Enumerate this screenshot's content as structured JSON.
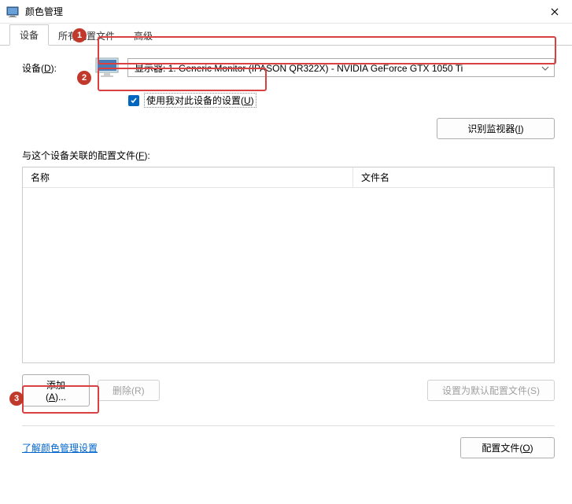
{
  "window": {
    "title": "颜色管理"
  },
  "tabs": {
    "device": "设备",
    "all_profiles": "所有配置文件",
    "advanced": "高级"
  },
  "device_section": {
    "label_prefix": "设备(",
    "label_key": "D",
    "label_suffix": "):",
    "dropdown_value": "显示器: 1. Generic Monitor (IPASON QR322X) - NVIDIA GeForce GTX 1050 Ti"
  },
  "checkbox": {
    "label_prefix": "使用我对此设备的设置(",
    "label_key": "U",
    "label_suffix": ")"
  },
  "identify_button": {
    "label_prefix": "识别监视器(",
    "label_key": "I",
    "label_suffix": ")"
  },
  "assoc": {
    "label_prefix": "与这个设备关联的配置文件(",
    "label_key": "F",
    "label_suffix": "):"
  },
  "columns": {
    "name": "名称",
    "filename": "文件名"
  },
  "buttons": {
    "add_prefix": "添加(",
    "add_key": "A",
    "add_suffix": ")...",
    "remove_prefix": "删除(",
    "remove_key": "R",
    "remove_suffix": ")",
    "default_prefix": "设置为默认配置文件(",
    "default_key": "S",
    "default_suffix": ")",
    "config_prefix": "配置文件(",
    "config_key": "O",
    "config_suffix": ")"
  },
  "link": {
    "text": "了解颜色管理设置"
  },
  "annotations": {
    "n1": "1",
    "n2": "2",
    "n3": "3"
  }
}
